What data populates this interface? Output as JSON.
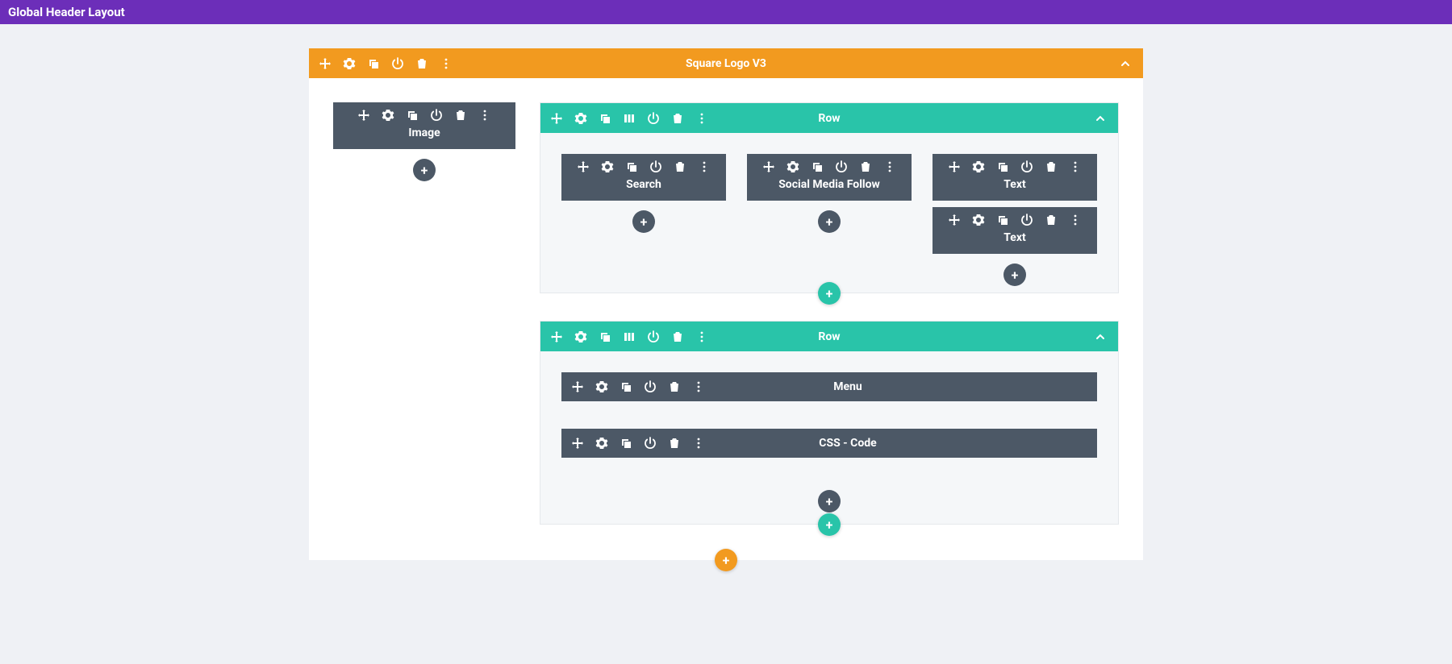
{
  "header": {
    "title": "Global Header Layout"
  },
  "section": {
    "title": "Square Logo V3"
  },
  "rows": {
    "row1_label": "Row",
    "row2_label": "Row"
  },
  "modules": {
    "image": "Image",
    "search": "Search",
    "social": "Social Media Follow",
    "text1": "Text",
    "text2": "Text",
    "menu": "Menu",
    "csscode": "CSS - Code"
  },
  "icons": {
    "plus": "+"
  }
}
